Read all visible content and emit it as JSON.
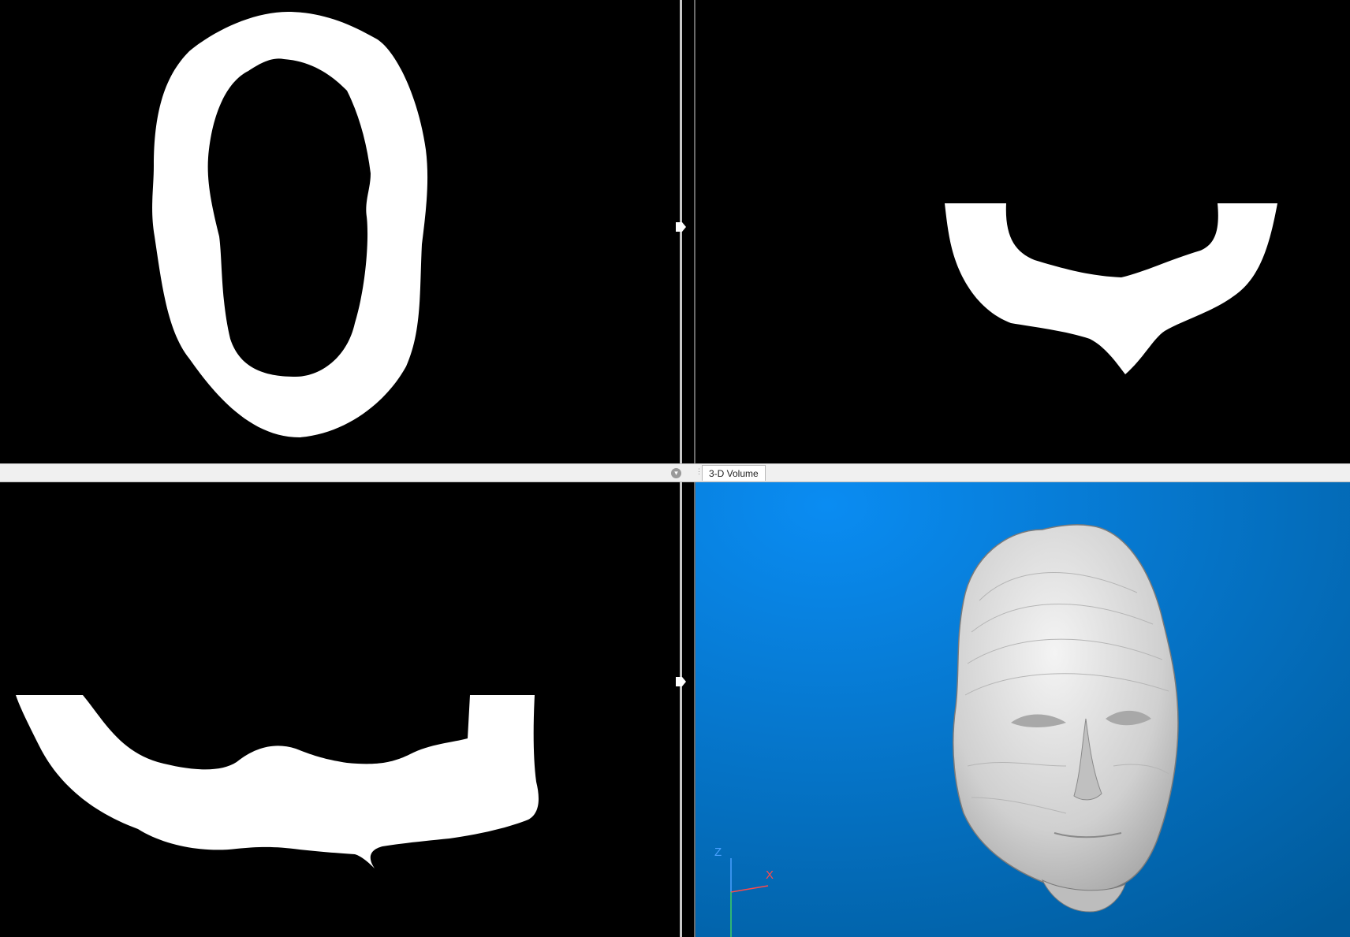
{
  "window": {
    "tab_label": "3-D Volume",
    "axis": {
      "z": "Z",
      "x": "X"
    }
  },
  "icons": {
    "splitter_handle": "triangle-right-icon",
    "pane_menu": "chevron-down-icon",
    "tab_grip": "grip-dots-icon"
  },
  "colors": {
    "background_2d": "#000000",
    "mask": "#ffffff",
    "volume_bg_top": "#0a8cf2",
    "volume_bg_bottom": "#005a9a",
    "axis_z": "#4aa0ff",
    "axis_x": "#ff4a4a",
    "axis_y": "#40d060"
  }
}
